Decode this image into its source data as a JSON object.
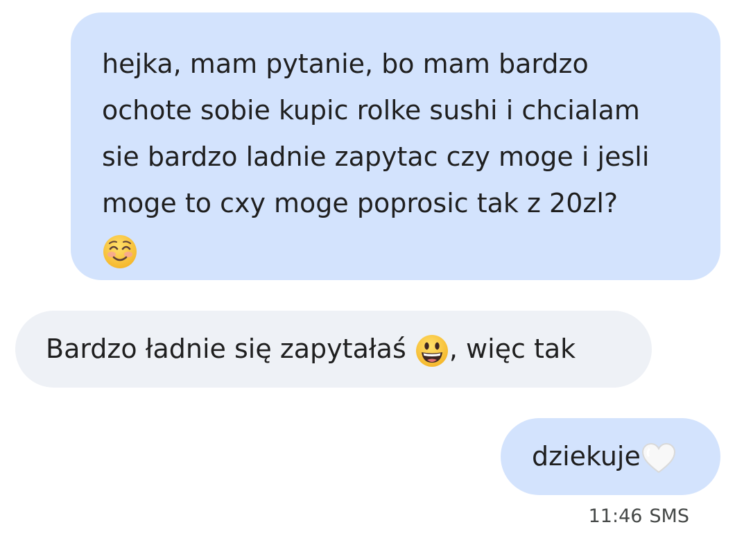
{
  "conversation": {
    "messages": [
      {
        "direction": "outgoing",
        "lines": [
          "hejka, mam pytanie, bo mam bardzo",
          "ochote sobie kupic rolke sushi i chcialam",
          "sie bardzo ladnie zapytac czy moge i jesli",
          "moge to cxy moge poprosic tak z 20zl?"
        ],
        "emoji": "smiling-face-with-smiling-eyes-icon"
      },
      {
        "direction": "incoming",
        "text_before_emoji": "Bardzo ładnie się zapytałaś ",
        "emoji": "grinning-face-icon",
        "text_after_emoji": ", więc tak"
      },
      {
        "direction": "outgoing",
        "text": "dziekuje",
        "emoji": "white-heart-icon"
      }
    ],
    "meta": {
      "time": "11:46",
      "type": "SMS"
    }
  },
  "colors": {
    "outgoing_bubble": "#d3e3fd",
    "incoming_bubble": "#eef1f6",
    "text": "#1f1f1f",
    "meta_text": "#444746",
    "background": "#ffffff"
  }
}
